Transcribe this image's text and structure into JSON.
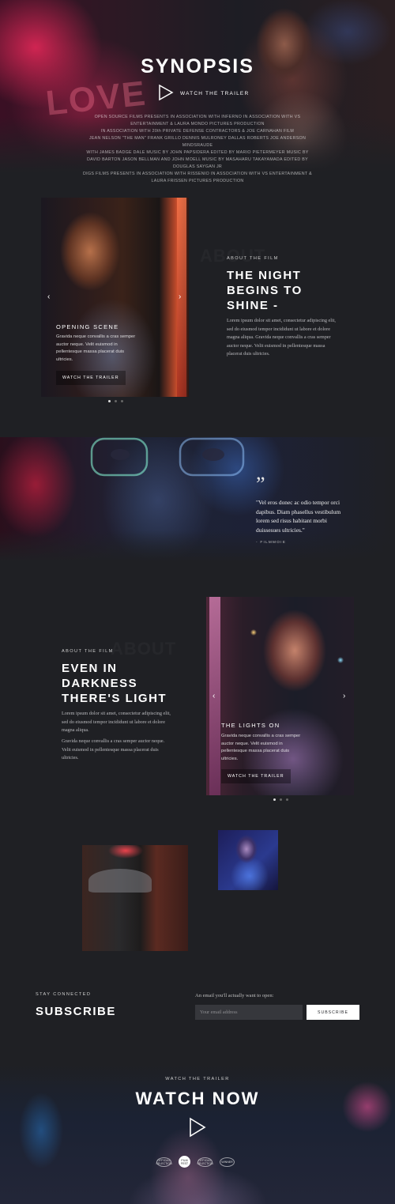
{
  "hero": {
    "title": "SYNOPSIS",
    "trailer_label": "WATCH THE TRAILER",
    "credits": [
      "OPEN SOURCE FILMS PRESENTS IN ASSOCIATION WITH INFERNO IN ASSOCIATION WITH VS ENTERTAINMENT & LAURA MONDO PICTURES PRODUCTION",
      "IN ASSOCIATION WITH 20th PRIVATE DEFENSE CONTRACTORS & JOE CARNAHAN FILM",
      "JEAN NELSON \"THE MAN\" FRANK GRILLO DENNIS MULRONEY DALLAS ROBERTS JOE ANDERSON MINDSRAUDE",
      "WITH JAMES BADGE DALE MUSIC BY JOHN PAPSIDERA EDITED BY MARIO PIETERMEYER MUSIC BY DAVID BARTON JASON BELLMAN AND JOHN MOELL MUSIC BY MASAHARU TAKAYAMADA EDITED BY",
      "DOUGLAS SAYGAN JR",
      "DIGS FILMS PRESENTS IN ASSOCIATION WITH RISSENIO IN ASSOCIATION WITH VS ENTERTAINMENT & LAURA FRISSEN PICTURES PRODUCTION"
    ]
  },
  "about1": {
    "ghost": "ABOUT",
    "eyebrow": "ABOUT THE FILM",
    "heading_lines": [
      "THE NIGHT",
      "BEGINS TO",
      "SHINE -"
    ],
    "paragraph": "Lorem ipsum dolor sit amet, consectetur adipiscing elit, sed do eiusmod tempor incididunt ut labore et dolore magna aliqua. Gravida neque convallis a cras semper auctor neque. Velit euismod in pellentesque massa placerat duis ultricies.",
    "slide": {
      "heading": "OPENING SCENE",
      "body": "Gravida neque convallis a cras semper auctor neque. Velit euismod in pellentesque massa placerat duis ultricies.",
      "button": "WATCH THE TRAILER",
      "prev": "‹",
      "next": "›"
    }
  },
  "quote": {
    "mark": "”",
    "text": "\"Vel eros donec ac odio tempor orci dapibus. Diam phasellus vestibulum lorem sed risus habitant morbi duissesues ultricies.\"",
    "source": "- FILMMOIE"
  },
  "about2": {
    "ghost": "ABOUT",
    "eyebrow": "ABOUT THE FILM",
    "heading_lines": [
      "EVEN IN",
      "DARKNESS",
      "THERE'S LIGHT"
    ],
    "paragraph1": "Lorem ipsum dolor sit amet, consectetur adipiscing elit, sed do eiusmod tempor incididunt ut labore et dolore magna aliqua.",
    "paragraph2": "Gravida neque convallis a cras semper auctor neque. Velit euismod in pellentesque massa placerat duis ultricies.",
    "slide": {
      "heading": "THE LIGHTS ON",
      "body": "Gravida neque convallis a cras semper auctor neque. Velit euismod in pellentesque massa placerat duis ultricies.",
      "button": "WATCH THE TRAILER",
      "prev": "‹",
      "next": "›"
    }
  },
  "subscribe": {
    "eyebrow": "STAY CONNECTED",
    "title": "SUBSCRIBE",
    "email_label": "An email you'll actually want to open:",
    "email_placeholder": "Your email address",
    "button": "SUBSCRIBE"
  },
  "footer": {
    "eyebrow": "WATCH THE TRAILER",
    "title": "WATCH NOW",
    "laurels": [
      "OFFICIAL SELECTION",
      "FILM FEST",
      "OFFICIAL SELECTION",
      "WINNER"
    ]
  }
}
